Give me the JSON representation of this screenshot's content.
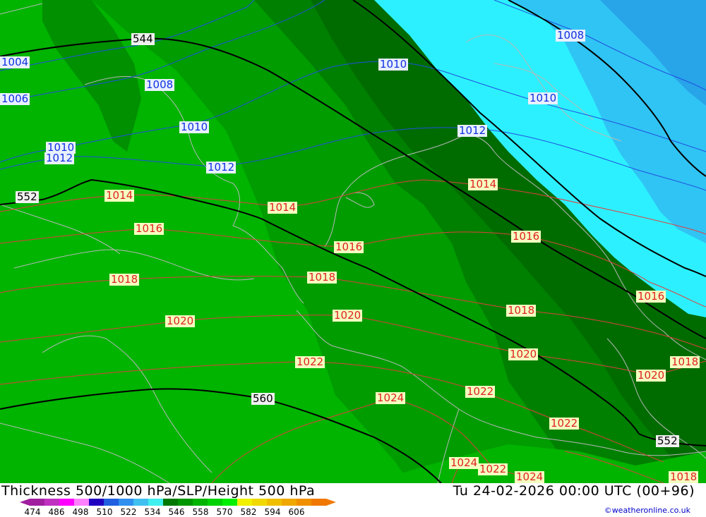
{
  "footer": {
    "title": "Thickness 500/1000 hPa/SLP/Height 500 hPa",
    "datetime": "Tu 24-02-2026 00:00 UTC (00+96)",
    "credit": "©weatheronline.co.uk"
  },
  "legend": {
    "values": [
      "474",
      "486",
      "498",
      "510",
      "522",
      "534",
      "546",
      "558",
      "570",
      "582",
      "594",
      "606"
    ],
    "colors": [
      "#a020a0",
      "#c030c0",
      "#ff00ff",
      "#ff80ff",
      "#2000c0",
      "#2060e0",
      "#3090f0",
      "#40c0f0",
      "#40f0f0",
      "#007800",
      "#009600",
      "#00b400",
      "#00d200",
      "#00f000",
      "#f0f000",
      "#f0d800",
      "#f0c000",
      "#f0a800",
      "#f09000",
      "#f07800"
    ]
  },
  "slp_labels": [
    {
      "text": "1004",
      "color": "blue"
    },
    {
      "text": "1006",
      "color": "blue"
    },
    {
      "text": "1008",
      "color": "blue"
    },
    {
      "text": "1008",
      "color": "blue"
    },
    {
      "text": "1010",
      "color": "blue"
    },
    {
      "text": "1010",
      "color": "blue"
    },
    {
      "text": "1010",
      "color": "blue"
    },
    {
      "text": "1010",
      "color": "blue"
    },
    {
      "text": "1012",
      "color": "blue"
    },
    {
      "text": "1012",
      "color": "blue"
    },
    {
      "text": "1012",
      "color": "blue"
    },
    {
      "text": "1014",
      "color": "red"
    },
    {
      "text": "1014",
      "color": "red"
    },
    {
      "text": "1014",
      "color": "red"
    },
    {
      "text": "1016",
      "color": "red"
    },
    {
      "text": "1016",
      "color": "red"
    },
    {
      "text": "1016",
      "color": "red"
    },
    {
      "text": "1016",
      "color": "red"
    },
    {
      "text": "1018",
      "color": "red"
    },
    {
      "text": "1018",
      "color": "red"
    },
    {
      "text": "1018",
      "color": "red"
    },
    {
      "text": "1018",
      "color": "red"
    },
    {
      "text": "1018",
      "color": "red"
    },
    {
      "text": "1020",
      "color": "red"
    },
    {
      "text": "1020",
      "color": "red"
    },
    {
      "text": "1020",
      "color": "red"
    },
    {
      "text": "1020",
      "color": "red"
    },
    {
      "text": "1022",
      "color": "red"
    },
    {
      "text": "1022",
      "color": "red"
    },
    {
      "text": "1022",
      "color": "red"
    },
    {
      "text": "1022",
      "color": "red"
    },
    {
      "text": "1024",
      "color": "red"
    },
    {
      "text": "1024",
      "color": "red"
    },
    {
      "text": "1024",
      "color": "red"
    }
  ],
  "height_labels": [
    {
      "text": "544"
    },
    {
      "text": "552"
    },
    {
      "text": "552"
    },
    {
      "text": "560"
    }
  ]
}
